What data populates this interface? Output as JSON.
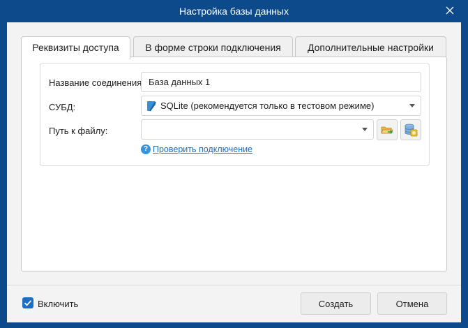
{
  "window": {
    "title": "Настройка базы данных"
  },
  "tabs": [
    {
      "label": "Реквизиты доступа",
      "active": true
    },
    {
      "label": "В форме строки подключения",
      "active": false
    },
    {
      "label": "Дополнительные настройки",
      "active": false
    }
  ],
  "form": {
    "connection_name_label": "Название соединения:",
    "connection_name_value": "База данных 1",
    "dbms_label": "СУБД:",
    "dbms_value": "SQLite (рекомендуется только в тестовом режиме)",
    "file_path_label": "Путь к файлу:",
    "file_path_value": "",
    "check_connection_link": "Проверить подключение"
  },
  "footer": {
    "enable_label": "Включить",
    "enable_checked": true,
    "create_button": "Создать",
    "cancel_button": "Отмена"
  },
  "icons": {
    "close": "close-icon",
    "db": "sqlite-icon",
    "browse": "open-folder-icon",
    "new_db": "new-database-icon",
    "help": "help-icon"
  },
  "colors": {
    "titlebar": "#0c4a8c",
    "accent": "#1a6fc4",
    "link": "#1a6fc4"
  }
}
